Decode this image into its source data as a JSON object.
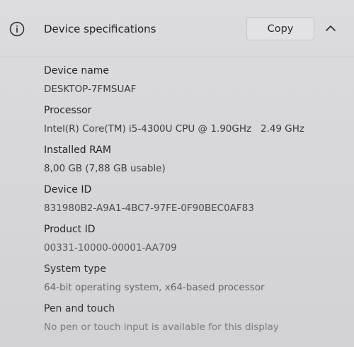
{
  "header": {
    "title": "Device specifications",
    "copy_label": "Copy",
    "info_icon": "info-circle-icon",
    "toggle_icon": "chevron-up-icon"
  },
  "specs": [
    {
      "label": "Device name",
      "value": "DESKTOP-7FMSUAF"
    },
    {
      "label": "Processor",
      "value": "Intel(R) Core(TM) i5-4300U CPU @ 1.90GHz   2.49 GHz"
    },
    {
      "label": "Installed RAM",
      "value": "8,00 GB (7,88 GB usable)"
    },
    {
      "label": "Device ID",
      "value": "831980B2-A9A1-4BC7-97FE-0F90BEC0AF83"
    },
    {
      "label": "Product ID",
      "value": "00331-10000-00001-AA709"
    },
    {
      "label": "System type",
      "value": "64-bit operating system, x64-based processor"
    },
    {
      "label": "Pen and touch",
      "value": "No pen or touch input is available for this display"
    }
  ]
}
